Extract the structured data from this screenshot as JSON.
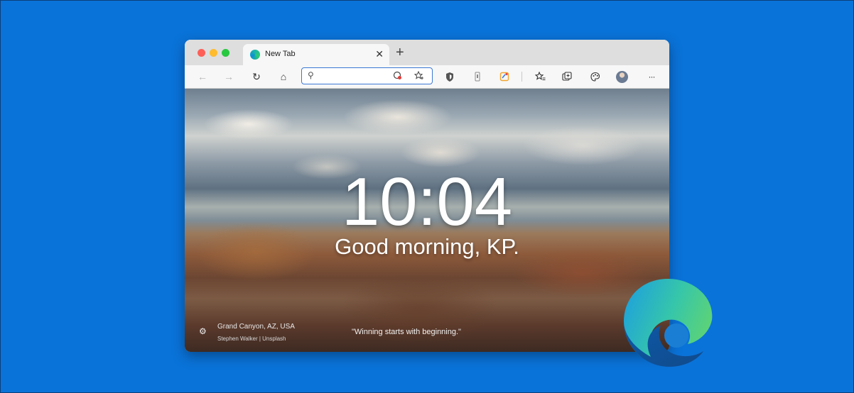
{
  "browser": {
    "tab": {
      "title": "New Tab",
      "close": "✕"
    },
    "new_tab": "+",
    "toolbar": {
      "back": "←",
      "forward": "→",
      "refresh": "↻",
      "home": "⌂",
      "search_glyph": "⚲",
      "more": "···"
    },
    "address": {
      "value": "",
      "placeholder": ""
    }
  },
  "newtab": {
    "time": "10:04",
    "greeting": "Good morning, KP.",
    "location": "Grand Canyon, AZ, USA",
    "credit": "Stephen Walker | Unsplash",
    "quote": "\"Winning starts with beginning.\""
  },
  "icons": {
    "background": "#0a73d9",
    "logo": "edge-logo"
  }
}
